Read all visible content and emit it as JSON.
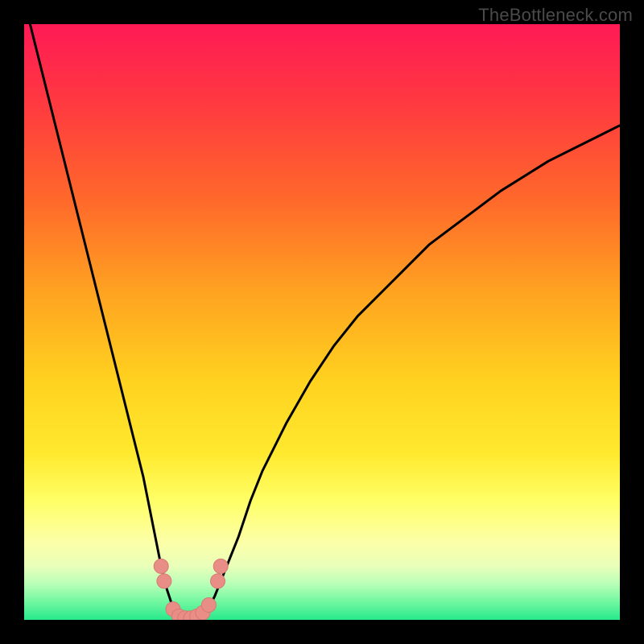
{
  "watermark": "TheBottleneck.com",
  "colors": {
    "frame": "#000000",
    "gradient_top": "#ff1a55",
    "gradient_bottom": "#28e98c",
    "curve_stroke": "#000000",
    "marker_fill": "#e98d87",
    "marker_stroke": "#d77a74"
  },
  "chart_data": {
    "type": "line",
    "title": "",
    "xlabel": "",
    "ylabel": "",
    "xlim": [
      0,
      100
    ],
    "ylim": [
      0,
      100
    ],
    "x": [
      0,
      2,
      4,
      6,
      8,
      10,
      12,
      14,
      16,
      18,
      20,
      22,
      23,
      24,
      25,
      26,
      27,
      28,
      29,
      30,
      31,
      32,
      34,
      36,
      38,
      40,
      44,
      48,
      52,
      56,
      60,
      64,
      68,
      72,
      76,
      80,
      84,
      88,
      92,
      96,
      100
    ],
    "series": [
      {
        "name": "bottleneck-curve",
        "values": [
          104,
          96,
          88,
          80,
          72,
          64,
          56,
          48,
          40,
          32,
          24,
          14,
          9,
          5,
          2,
          0.5,
          0,
          0,
          0,
          0.5,
          2,
          4,
          9,
          14,
          20,
          25,
          33,
          40,
          46,
          51,
          55,
          59,
          63,
          66,
          69,
          72,
          74.5,
          77,
          79,
          81,
          83
        ]
      }
    ],
    "markers": [
      {
        "x": 23.0,
        "y": 9.0
      },
      {
        "x": 23.5,
        "y": 6.5
      },
      {
        "x": 25.0,
        "y": 1.8
      },
      {
        "x": 26.0,
        "y": 0.6
      },
      {
        "x": 27.0,
        "y": 0.3
      },
      {
        "x": 28.0,
        "y": 0.3
      },
      {
        "x": 29.0,
        "y": 0.6
      },
      {
        "x": 30.0,
        "y": 1.2
      },
      {
        "x": 31.0,
        "y": 2.5
      },
      {
        "x": 32.5,
        "y": 6.5
      },
      {
        "x": 33.0,
        "y": 9.0
      }
    ]
  }
}
